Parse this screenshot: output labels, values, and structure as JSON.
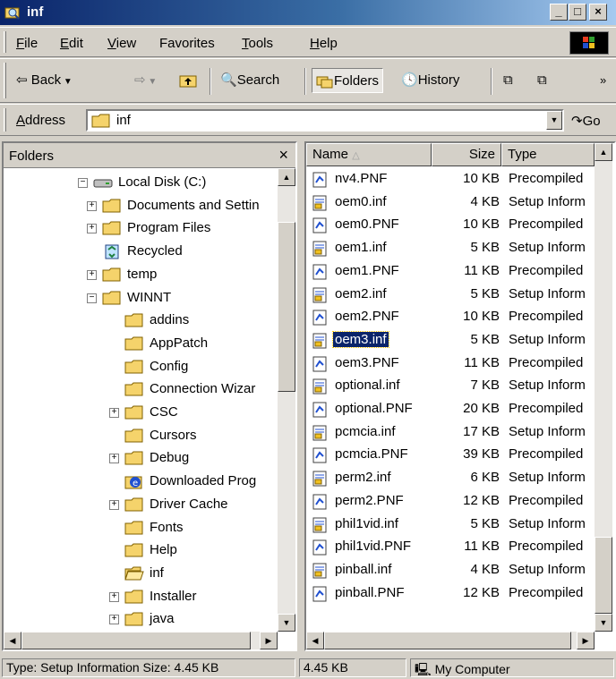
{
  "window": {
    "title": "inf",
    "minimize": "_",
    "maximize": "□",
    "close": "×"
  },
  "menubar": {
    "items": [
      {
        "first": "F",
        "rest": "ile"
      },
      {
        "first": "E",
        "rest": "dit"
      },
      {
        "first": "V",
        "rest": "iew"
      },
      {
        "first": "Fa",
        "rest": "vorites",
        "underline_index": 1
      },
      {
        "first": "T",
        "rest": "ools"
      },
      {
        "first": "H",
        "rest": "elp"
      }
    ]
  },
  "toolbar": {
    "back": "Back",
    "search": "Search",
    "folders": "Folders",
    "history": "History",
    "more": "»"
  },
  "address": {
    "label_u": "A",
    "label_rest": "ddress",
    "value": "inf",
    "go": "Go"
  },
  "folders_pane": {
    "title": "Folders",
    "close": "×",
    "items": [
      {
        "label": "Local Disk (C:)",
        "icon": "drive-icon",
        "indent": 0,
        "expander": "−"
      },
      {
        "label": "Documents and Settin",
        "icon": "folder-icon",
        "indent": 1,
        "expander": "+"
      },
      {
        "label": "Program Files",
        "icon": "folder-icon",
        "indent": 1,
        "expander": "+"
      },
      {
        "label": "Recycled",
        "icon": "recycle-icon",
        "indent": 1,
        "expander": ""
      },
      {
        "label": "temp",
        "icon": "folder-icon",
        "indent": 1,
        "expander": "+"
      },
      {
        "label": "WINNT",
        "icon": "folder-icon",
        "indent": 1,
        "expander": "−"
      },
      {
        "label": "addins",
        "icon": "folder-icon",
        "indent": 2,
        "expander": ""
      },
      {
        "label": "AppPatch",
        "icon": "folder-icon",
        "indent": 2,
        "expander": ""
      },
      {
        "label": "Config",
        "icon": "folder-icon",
        "indent": 2,
        "expander": ""
      },
      {
        "label": "Connection Wizar",
        "icon": "folder-icon",
        "indent": 2,
        "expander": ""
      },
      {
        "label": "CSC",
        "icon": "folder-icon",
        "indent": 2,
        "expander": "+"
      },
      {
        "label": "Cursors",
        "icon": "folder-icon",
        "indent": 2,
        "expander": ""
      },
      {
        "label": "Debug",
        "icon": "folder-icon",
        "indent": 2,
        "expander": "+"
      },
      {
        "label": "Downloaded Prog",
        "icon": "ie-icon",
        "indent": 2,
        "expander": ""
      },
      {
        "label": "Driver Cache",
        "icon": "folder-icon",
        "indent": 2,
        "expander": "+"
      },
      {
        "label": "Fonts",
        "icon": "folder-icon",
        "indent": 2,
        "expander": ""
      },
      {
        "label": "Help",
        "icon": "folder-icon",
        "indent": 2,
        "expander": ""
      },
      {
        "label": "inf",
        "icon": "open-folder-icon",
        "indent": 2,
        "expander": ""
      },
      {
        "label": "Installer",
        "icon": "folder-icon",
        "indent": 2,
        "expander": "+"
      },
      {
        "label": "java",
        "icon": "folder-icon",
        "indent": 2,
        "expander": "+"
      }
    ]
  },
  "files_pane": {
    "columns": {
      "name": "Name",
      "size": "Size",
      "type": "Type"
    },
    "files": [
      {
        "name": "nv4.PNF",
        "size": "10 KB",
        "type": "Precompiled",
        "icon": "pnf-icon"
      },
      {
        "name": "oem0.inf",
        "size": "4 KB",
        "type": "Setup Inform",
        "icon": "inf-icon"
      },
      {
        "name": "oem0.PNF",
        "size": "10 KB",
        "type": "Precompiled",
        "icon": "pnf-icon"
      },
      {
        "name": "oem1.inf",
        "size": "5 KB",
        "type": "Setup Inform",
        "icon": "inf-icon"
      },
      {
        "name": "oem1.PNF",
        "size": "11 KB",
        "type": "Precompiled",
        "icon": "pnf-icon"
      },
      {
        "name": "oem2.inf",
        "size": "5 KB",
        "type": "Setup Inform",
        "icon": "inf-icon"
      },
      {
        "name": "oem2.PNF",
        "size": "10 KB",
        "type": "Precompiled",
        "icon": "pnf-icon"
      },
      {
        "name": "oem3.inf",
        "size": "5 KB",
        "type": "Setup Inform",
        "icon": "inf-icon",
        "selected": true
      },
      {
        "name": "oem3.PNF",
        "size": "11 KB",
        "type": "Precompiled",
        "icon": "pnf-icon"
      },
      {
        "name": "optional.inf",
        "size": "7 KB",
        "type": "Setup Inform",
        "icon": "inf-icon"
      },
      {
        "name": "optional.PNF",
        "size": "20 KB",
        "type": "Precompiled",
        "icon": "pnf-icon"
      },
      {
        "name": "pcmcia.inf",
        "size": "17 KB",
        "type": "Setup Inform",
        "icon": "inf-icon"
      },
      {
        "name": "pcmcia.PNF",
        "size": "39 KB",
        "type": "Precompiled",
        "icon": "pnf-icon"
      },
      {
        "name": "perm2.inf",
        "size": "6 KB",
        "type": "Setup Inform",
        "icon": "inf-icon"
      },
      {
        "name": "perm2.PNF",
        "size": "12 KB",
        "type": "Precompiled",
        "icon": "pnf-icon"
      },
      {
        "name": "phil1vid.inf",
        "size": "5 KB",
        "type": "Setup Inform",
        "icon": "inf-icon"
      },
      {
        "name": "phil1vid.PNF",
        "size": "11 KB",
        "type": "Precompiled",
        "icon": "pnf-icon"
      },
      {
        "name": "pinball.inf",
        "size": "4 KB",
        "type": "Setup Inform",
        "icon": "inf-icon"
      },
      {
        "name": "pinball.PNF",
        "size": "12 KB",
        "type": "Precompiled",
        "icon": "pnf-icon"
      }
    ]
  },
  "statusbar": {
    "info": "Type: Setup Information Size: 4.45 KB",
    "size": "4.45 KB",
    "zone": "My Computer"
  },
  "colors": {
    "titlebar_start": "#0a246a",
    "titlebar_end": "#a6caf0",
    "selection": "#0a246a",
    "face": "#d4d0c8"
  }
}
